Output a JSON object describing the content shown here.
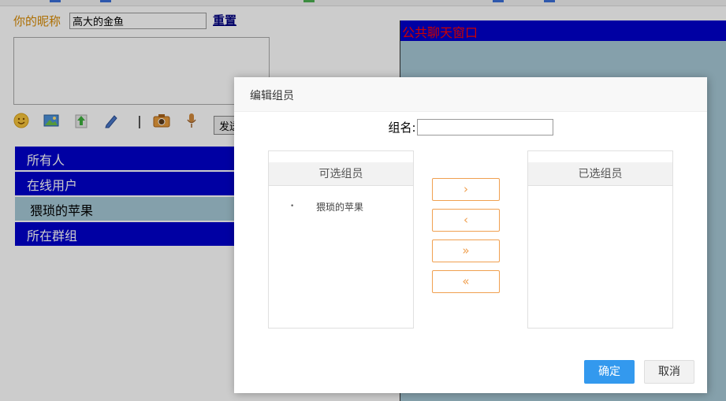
{
  "background": {
    "nickname_label": "你的昵称",
    "nickname_value": "高大的金鱼",
    "reset_label": "重置",
    "send_label": "发送",
    "toolbar_icons": [
      "smiley-icon",
      "image-icon",
      "upload-icon",
      "pen-icon",
      "separator",
      "camera-icon",
      "microphone-icon"
    ],
    "user_list": [
      {
        "label": "所有人",
        "type": "header"
      },
      {
        "label": "在线用户",
        "type": "header"
      },
      {
        "label": "猥琐的苹果",
        "type": "user"
      },
      {
        "label": "所在群组",
        "type": "header"
      }
    ],
    "chat_title": "公共聊天窗口"
  },
  "dialog": {
    "title": "编辑组员",
    "group_name_label": "组名:",
    "group_name_value": "",
    "available_title": "可选组员",
    "available_items": [
      "猥琐的苹果"
    ],
    "selected_title": "已选组员",
    "selected_items": [],
    "buttons": {
      "move_right": "›",
      "move_left": "‹",
      "move_all_right": "»",
      "move_all_left": "«",
      "confirm": "确定",
      "cancel": "取消"
    }
  },
  "colors": {
    "accent_blue": "#0000cc",
    "orange": "#f0a050",
    "confirm_blue": "#3399ee",
    "chat_bg": "#a7c8d6"
  }
}
